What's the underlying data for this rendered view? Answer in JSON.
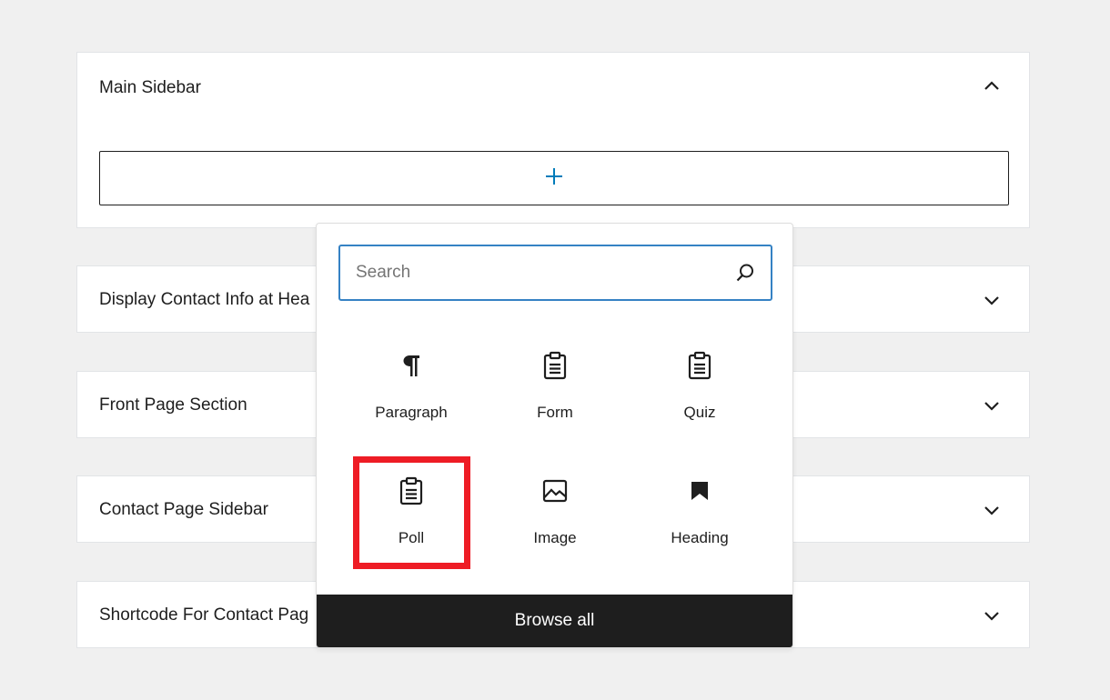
{
  "main_panel": {
    "title": "Main Sidebar",
    "toggle_icon": "chevron-up-icon",
    "add_block_icon": "plus-icon",
    "accent_color": "#007cba"
  },
  "panels": [
    {
      "title": "Display Contact Info at Hea",
      "toggle_icon": "chevron-down-icon"
    },
    {
      "title": "Front Page Section",
      "toggle_icon": "chevron-down-icon"
    },
    {
      "title": "Contact Page Sidebar",
      "toggle_icon": "chevron-down-icon"
    },
    {
      "title": "Shortcode For Contact Pag",
      "toggle_icon": "chevron-down-icon"
    }
  ],
  "inserter": {
    "search": {
      "placeholder": "Search",
      "value": "",
      "icon": "search-icon"
    },
    "blocks": [
      {
        "label": "Paragraph",
        "icon": "paragraph-icon"
      },
      {
        "label": "Form",
        "icon": "clipboard-icon"
      },
      {
        "label": "Quiz",
        "icon": "clipboard-icon"
      },
      {
        "label": "Poll",
        "icon": "clipboard-icon"
      },
      {
        "label": "Image",
        "icon": "image-icon"
      },
      {
        "label": "Heading",
        "icon": "bookmark-icon"
      }
    ],
    "highlighted_block": "Poll",
    "highlight_color": "#ee1c25",
    "browse_all_label": "Browse all"
  }
}
